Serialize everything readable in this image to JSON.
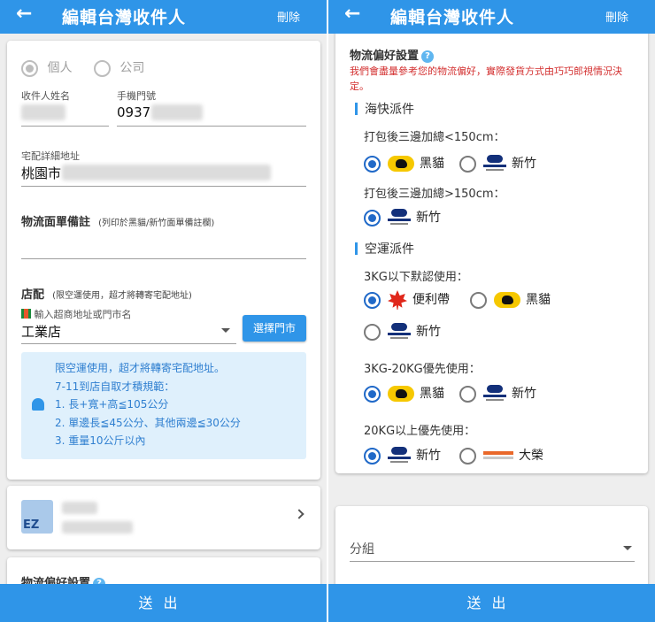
{
  "header": {
    "title": "編輯台灣收件人",
    "delete_label": "刪除",
    "back_icon": "arrow-left-icon"
  },
  "footer": {
    "submit_label": "送出"
  },
  "left": {
    "recipient_type": {
      "options": [
        "個人",
        "公司"
      ],
      "selected": "個人"
    },
    "name_label": "收件人姓名",
    "phone_label": "手機門號",
    "phone_value": "0937",
    "address_label": "宅配詳細地址",
    "address_value": "桃園市",
    "remark_label": "物流面單備註",
    "remark_hint": "(列印於黑貓/新竹面單備註欄)",
    "store_label": "店配",
    "store_hint": "(限空運使用，超才將轉寄宅配地址)",
    "store_input_label": "輸入超商地址或門市名",
    "store_value": "工業店",
    "select_store_button": "選擇門市",
    "notice": {
      "line1": "限空運使用，超才將轉寄宅配地址。",
      "line2": "7-11到店自取才積規範：",
      "line3": "1. 長+寬+高≦105公分",
      "line4": "2. 單邊長≦45公分、其他兩邊≦30公分",
      "line5": "3. 重量10公斤以內"
    },
    "app_logo_text": "EZ",
    "pref_title_partial": "物流偏好設置"
  },
  "right": {
    "pref_title": "物流偏好設置",
    "pref_note": "我們會盡量參考您的物流偏好，實際發貨方式由巧巧郎視情況決定。",
    "sea": {
      "title": "海快派件",
      "group1_label": "打包後三邊加總<150cm：",
      "group1_options": [
        "黑貓",
        "新竹"
      ],
      "group2_label": "打包後三邊加總>150cm：",
      "group2_options": [
        "新竹"
      ]
    },
    "air": {
      "title": "空運派件",
      "group1_label": "3KG以下默認使用：",
      "group1_options": [
        "便利帶",
        "黑貓",
        "新竹"
      ],
      "group2_label": "3KG-20KG優先使用：",
      "group2_options": [
        "黑貓",
        "新竹"
      ],
      "group3_label": "20KG以上優先使用：",
      "group3_options": [
        "新竹",
        "大榮"
      ]
    },
    "group_select_label": "分組"
  },
  "colors": {
    "primary": "#2f95e8",
    "radio_on": "#2069c8",
    "note_red": "#d32f2f",
    "notice_bg": "#dff0fc"
  }
}
